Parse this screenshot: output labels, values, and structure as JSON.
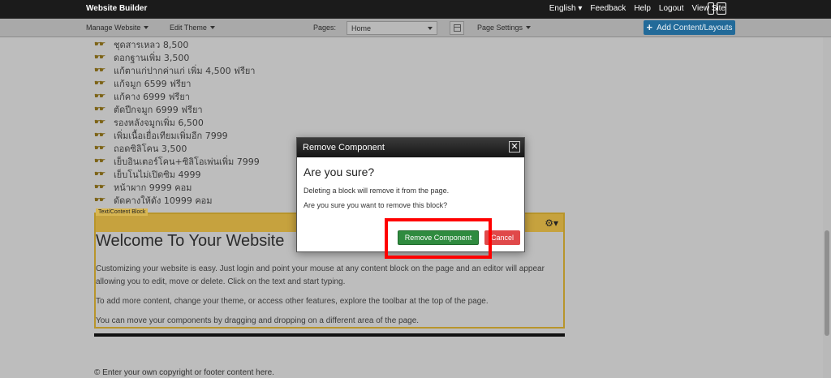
{
  "topbar": {
    "brand": "Website Builder",
    "links": [
      "English",
      "Feedback",
      "Help",
      "Logout",
      "View Site"
    ],
    "english_caret": "▾"
  },
  "toolbar": {
    "manage_website": "Manage Website",
    "edit_theme": "Edit Theme",
    "pages_label": "Pages:",
    "pages_value": "Home",
    "page_settings": "Page Settings",
    "add_content": "Add Content/Layouts"
  },
  "list_items": [
    "ชุดสารเหลว 8,500",
    "ดอกฐานเพิ่ม 3,500",
    "แก้ตาแก่ปากค่าแก่ เพิ่ม 4,500 ฟรียา",
    "แก้จมูก 6599 ฟรียา",
    "แก้คาง  6999  ฟรียา",
    "ตัดปีกจมูก 6999 ฟรียา",
    "รองหลังจมูกเพิ่ม 6,500",
    "เพิ่มเนื้อเยื่อเทียมเพิ่มอีก 7999",
    "ถอดซิลิโคน 3,500",
    "เย็บอินเตอร์โคน+ซิลิโอเพ่นเพิ่ม 7999",
    "เย็บโนไม่เปิดซิม  4999",
    "หน้าผาก  9999 คอม",
    "ดัดคางให้ดัง 10999  คอม"
  ],
  "block": {
    "tag": "Text/Content Block",
    "title": "Welcome To Your Website",
    "para1": "Customizing your website is easy. Just login and point your mouse at any content block on the page and an editor will appear allowing you to edit, move or delete.  Click on the text and start typing.",
    "para2": "To add more content, change your theme, or access other features, explore the toolbar at the top of the page.",
    "para3": "You can move your components by dragging and dropping on a different area of the page."
  },
  "footer": "© Enter your own copyright or footer content here.",
  "modal": {
    "title": "Remove Component",
    "heading": "Are you sure?",
    "line1": "Deleting a block will remove it from the page.",
    "line2": "Are you sure you want to remove this block?",
    "remove_label": "Remove Component",
    "cancel_label": "Cancel",
    "close_symbol": "✕"
  },
  "colors": {
    "highlight": "#ff0000",
    "remove_button": "#2f8b3f",
    "cancel_button": "#e0494a",
    "add_button": "#226a99"
  }
}
